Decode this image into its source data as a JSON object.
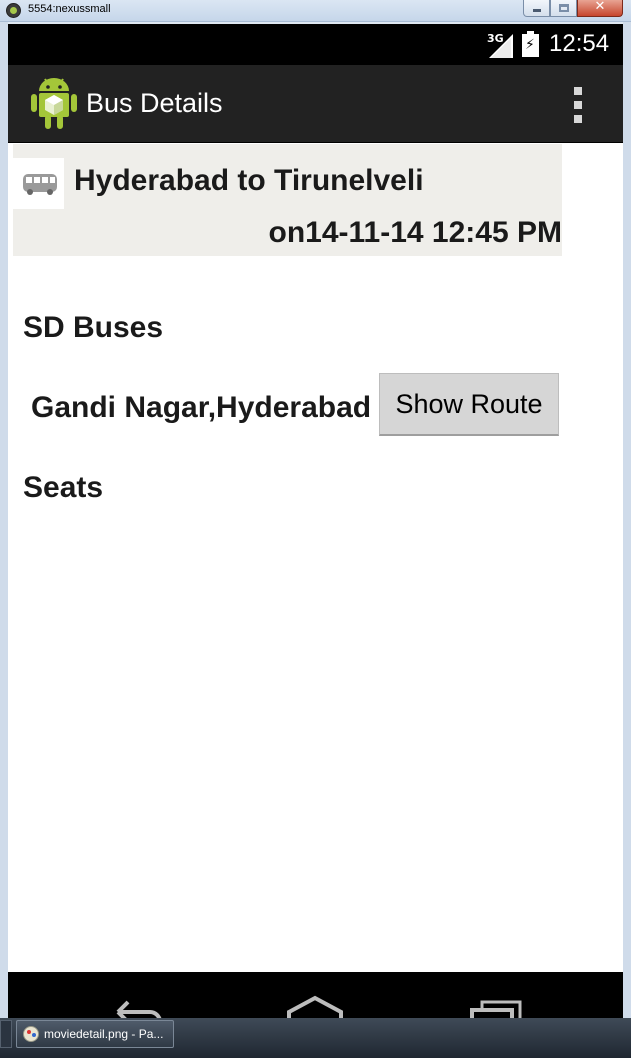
{
  "window": {
    "title": "5554:nexussmall",
    "close_glyph": "✕"
  },
  "status_bar": {
    "network": "3G",
    "time": "12:54",
    "icons": [
      "signal-icon",
      "battery-charging-icon"
    ]
  },
  "action_bar": {
    "title": "Bus Details",
    "logo_icon": "android-app-icon",
    "menu_icon": "overflow-menu-icon"
  },
  "trip": {
    "icon": "bus-icon",
    "route": "Hyderabad to Tirunelveli",
    "datetime": "on14-11-14 12:45 PM"
  },
  "operator": {
    "name": "SD Buses",
    "boarding_point": "Gandi Nagar,Hyderabad",
    "show_route_label": "Show Route"
  },
  "seats": {
    "label": "Seats"
  },
  "nav_bar": {
    "icons": [
      "back-icon",
      "home-icon",
      "recents-icon"
    ]
  },
  "taskbar": {
    "item_label": "moviedetail.png - Pa..."
  },
  "colors": {
    "action_bar": "#222222",
    "header_bg": "#efeeea",
    "button_bg": "#d6d6d6",
    "android_green": "#a4c639"
  }
}
